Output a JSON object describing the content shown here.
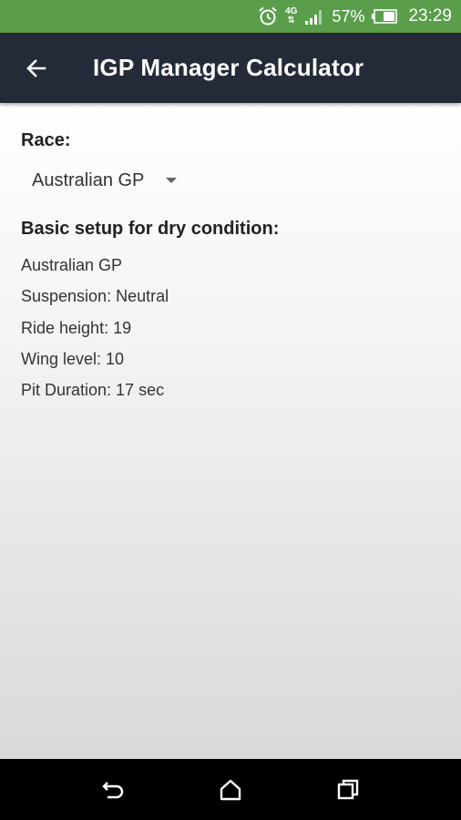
{
  "status_bar": {
    "network": "4G",
    "battery_percent": "57%",
    "time": "23:29",
    "icons": [
      "alarm-icon",
      "network-4g-icon",
      "signal-icon",
      "battery-icon"
    ],
    "color": "#5a9e4b"
  },
  "app_bar": {
    "title": "IGP Manager Calculator",
    "back_icon": "arrow-back-icon",
    "color": "#242a37"
  },
  "form": {
    "race_label": "Race:",
    "race_selected": "Australian GP"
  },
  "setup": {
    "title": "Basic setup for dry condition:",
    "lines": [
      "Australian GP",
      "Suspension: Neutral",
      "Ride height: 19",
      "Wing level: 10",
      "Pit Duration: 17 sec"
    ]
  },
  "nav_bar": {
    "icons": [
      "back-nav-icon",
      "home-icon",
      "recents-icon"
    ]
  }
}
